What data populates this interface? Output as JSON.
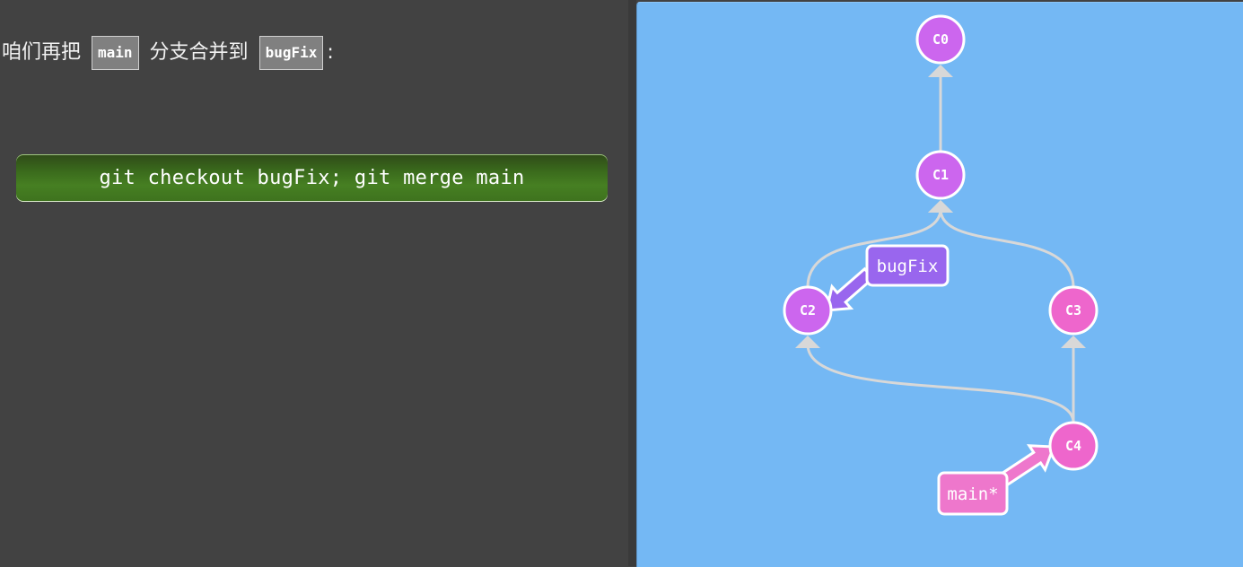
{
  "instruction": {
    "prefix": "咱们再把",
    "source_branch": "main",
    "middle": "分支合并到",
    "target_branch": "bugFix",
    "suffix": ":"
  },
  "command": {
    "text": "git checkout bugFix; git merge main"
  },
  "graph": {
    "commits": [
      {
        "id": "C0",
        "color": "#cc66ee"
      },
      {
        "id": "C1",
        "color": "#cc66ee"
      },
      {
        "id": "C2",
        "color": "#cc66ee"
      },
      {
        "id": "C3",
        "color": "#ee66cc"
      },
      {
        "id": "C4",
        "color": "#ee66cc"
      }
    ],
    "branches": [
      {
        "name": "bugFix",
        "target": "C2",
        "color": "#9966ee"
      },
      {
        "name": "main*",
        "target": "C4",
        "color": "#ee77cc"
      }
    ],
    "edge_color": "#d8d8d8",
    "background_color": "#74b8f4"
  }
}
